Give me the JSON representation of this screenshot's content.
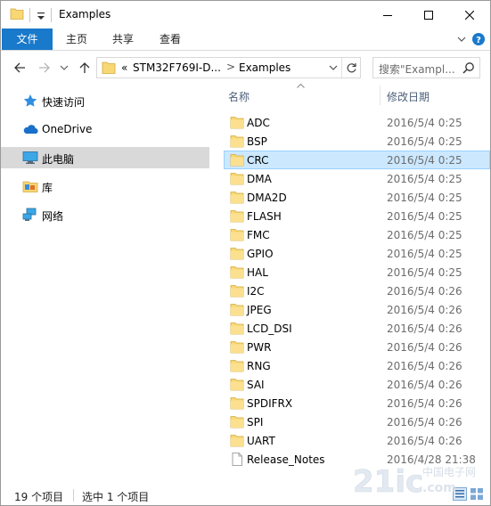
{
  "window": {
    "title": "Examples"
  },
  "ribbon": {
    "tabs": [
      "文件",
      "主页",
      "共享",
      "查看"
    ]
  },
  "address": {
    "overflow": "«",
    "segments": [
      "STM32F769I-D...",
      "Examples"
    ],
    "separator": ">"
  },
  "search": {
    "placeholder": "搜索\"Exampl..."
  },
  "nav": {
    "items": [
      {
        "label": "快速访问",
        "icon": "star-icon"
      },
      {
        "label": "OneDrive",
        "icon": "cloud-icon"
      },
      {
        "label": "此电脑",
        "icon": "computer-icon",
        "selected": true
      },
      {
        "label": "库",
        "icon": "library-icon"
      },
      {
        "label": "网络",
        "icon": "network-icon"
      }
    ]
  },
  "columns": {
    "name": "名称",
    "date": "修改日期"
  },
  "files": [
    {
      "name": "ADC",
      "date": "2016/5/4 0:25",
      "type": "folder"
    },
    {
      "name": "BSP",
      "date": "2016/5/4 0:25",
      "type": "folder"
    },
    {
      "name": "CRC",
      "date": "2016/5/4 0:25",
      "type": "folder",
      "selected": true
    },
    {
      "name": "DMA",
      "date": "2016/5/4 0:25",
      "type": "folder"
    },
    {
      "name": "DMA2D",
      "date": "2016/5/4 0:25",
      "type": "folder"
    },
    {
      "name": "FLASH",
      "date": "2016/5/4 0:25",
      "type": "folder"
    },
    {
      "name": "FMC",
      "date": "2016/5/4 0:25",
      "type": "folder"
    },
    {
      "name": "GPIO",
      "date": "2016/5/4 0:25",
      "type": "folder"
    },
    {
      "name": "HAL",
      "date": "2016/5/4 0:25",
      "type": "folder"
    },
    {
      "name": "I2C",
      "date": "2016/5/4 0:26",
      "type": "folder"
    },
    {
      "name": "JPEG",
      "date": "2016/5/4 0:26",
      "type": "folder"
    },
    {
      "name": "LCD_DSI",
      "date": "2016/5/4 0:26",
      "type": "folder"
    },
    {
      "name": "PWR",
      "date": "2016/5/4 0:26",
      "type": "folder"
    },
    {
      "name": "RNG",
      "date": "2016/5/4 0:26",
      "type": "folder"
    },
    {
      "name": "SAI",
      "date": "2016/5/4 0:26",
      "type": "folder"
    },
    {
      "name": "SPDIFRX",
      "date": "2016/5/4 0:26",
      "type": "folder"
    },
    {
      "name": "SPI",
      "date": "2016/5/4 0:26",
      "type": "folder"
    },
    {
      "name": "UART",
      "date": "2016/5/4 0:26",
      "type": "folder"
    },
    {
      "name": "Release_Notes",
      "date": "2016/4/28 21:38",
      "type": "file"
    }
  ],
  "status": {
    "count": "19 个项目",
    "selection": "选中 1 个项目"
  },
  "watermark": {
    "text": "21ic.com",
    "subtext": "中国电子网"
  },
  "colors": {
    "accent": "#1979ca",
    "selection": "#cce8ff",
    "selection_border": "#99d1ff",
    "folder": "#f8d775"
  }
}
